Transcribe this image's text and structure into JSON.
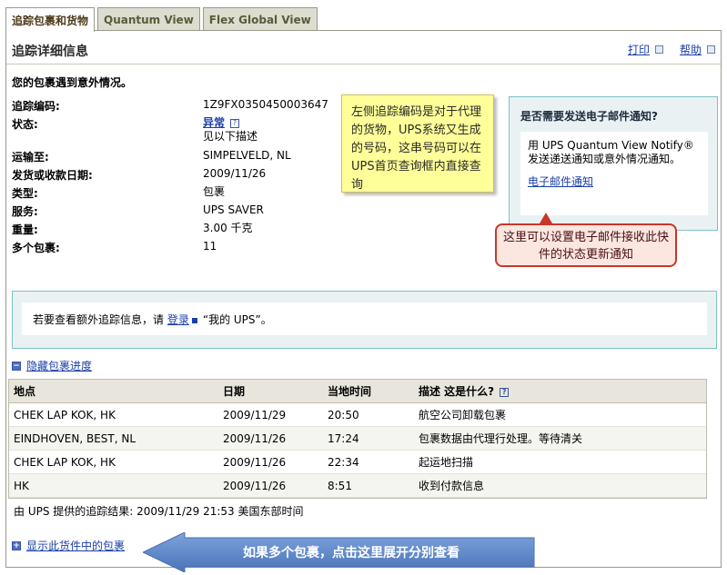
{
  "tabs": [
    "追踪包裹和货物",
    "Quantum View",
    "Flex Global View"
  ],
  "header": {
    "title": "追踪详细信息",
    "print": "打印",
    "help": "帮助"
  },
  "alert": "您的包裹遇到意外情况。",
  "details": [
    {
      "label": "追踪编码:",
      "value": "1Z9FX0350450003647"
    },
    {
      "label": "状态:",
      "value": "异常",
      "sub": "见以下描述"
    },
    {
      "label": "运输至:",
      "value": "SIMPELVELD, NL"
    },
    {
      "label": "发货或收款日期:",
      "value": "2009/11/26"
    },
    {
      "label": "类型:",
      "value": "包裹"
    },
    {
      "label": "服务:",
      "value": "UPS SAVER"
    },
    {
      "label": "重量:",
      "value": "3.00 千克"
    },
    {
      "label": "多个包裹:",
      "value": "11"
    }
  ],
  "callout_yellow": "左侧追踪编码是对于代理的货物，UPS系统又生成的号码，这串号码可以在UPS首页查询框内直接查询",
  "notify": {
    "heading": "是否需要发送电子邮件通知?",
    "body": "用 UPS Quantum View Notify® 发送递送通知或意外情况通知。",
    "link": "电子邮件通知"
  },
  "callout_red": "这里可以设置电子邮件接收此快件的状态更新通知",
  "login": {
    "prefix": "若要查看额外追踪信息，请",
    "link": "登录",
    "suffix": "“我的 UPS”。"
  },
  "hide_progress": "隐藏包裹进度",
  "table": {
    "headers": [
      "地点",
      "日期",
      "当地时间",
      "描述   这是什么?"
    ],
    "rows": [
      [
        "CHEK LAP KOK, HK",
        "2009/11/29",
        "20:50",
        "航空公司卸载包裹"
      ],
      [
        "EINDHOVEN, BEST, NL",
        "2009/11/26",
        "17:24",
        "包裹数据由代理行处理。等待清关"
      ],
      [
        "CHEK LAP KOK, HK",
        "2009/11/26",
        "22:34",
        "起运地扫描"
      ],
      [
        "HK",
        "2009/11/26",
        "8:51",
        "收到付款信息"
      ]
    ]
  },
  "source": "由  UPS 提供的追踪结果:   2009/11/29 21:53  美国东部时间",
  "show_packages": "显示此货件中的包裹",
  "arrow_text": "如果多个包裹，点击这里展开分别查看",
  "colors": {
    "link": "#1a3fa8",
    "teal_border": "#7fc3c3",
    "arrow": "#5a84c8"
  }
}
